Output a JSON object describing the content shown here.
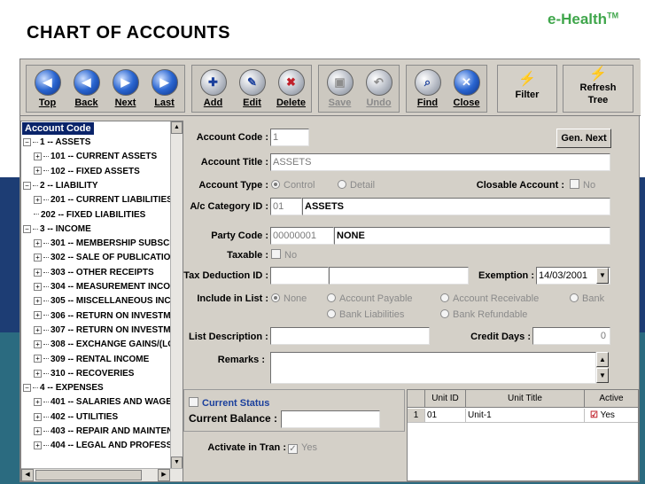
{
  "slide": {
    "title": "CHART OF ACCOUNTS",
    "brand": "e-Health",
    "brand_tm": "TM"
  },
  "toolbar": {
    "nav": [
      {
        "label": "Top",
        "icon": "arrow-first-icon"
      },
      {
        "label": "Back",
        "icon": "arrow-back-icon"
      },
      {
        "label": "Next",
        "icon": "arrow-next-icon"
      },
      {
        "label": "Last",
        "icon": "arrow-last-icon"
      }
    ],
    "edit": [
      {
        "label": "Add",
        "icon": "add-document-icon"
      },
      {
        "label": "Edit",
        "icon": "edit-document-icon"
      },
      {
        "label": "Delete",
        "icon": "delete-document-icon"
      }
    ],
    "save": [
      {
        "label": "Save",
        "icon": "save-icon",
        "disabled": true
      },
      {
        "label": "Undo",
        "icon": "undo-icon",
        "disabled": true
      }
    ],
    "find": [
      {
        "label": "Find",
        "icon": "find-icon"
      },
      {
        "label": "Close",
        "icon": "close-icon"
      }
    ],
    "filter": {
      "label": "Filter",
      "icon": "lightning-icon"
    },
    "refresh": {
      "label1": "Refresh",
      "label2": "Tree",
      "icon": "lightning-icon"
    }
  },
  "tree": {
    "header": "Account Code",
    "items": [
      {
        "text": "1 -- ASSETS",
        "level": 0,
        "expander": "−"
      },
      {
        "text": "101 -- CURRENT ASSETS",
        "level": 1,
        "expander": "+"
      },
      {
        "text": "102 -- FIXED ASSETS",
        "level": 1,
        "expander": "+"
      },
      {
        "text": "2 -- LIABILITY",
        "level": 0,
        "expander": "−"
      },
      {
        "text": "201 -- CURRENT LIABILITIES",
        "level": 1,
        "expander": "+"
      },
      {
        "text": "202 -- FIXED LIABILITIES",
        "level": 1,
        "expander": ""
      },
      {
        "text": "3 -- INCOME",
        "level": 0,
        "expander": "−"
      },
      {
        "text": "301 -- MEMBERSHIP SUBSCR",
        "level": 1,
        "expander": "+"
      },
      {
        "text": "302 -- SALE OF PUBLICATIO",
        "level": 1,
        "expander": "+"
      },
      {
        "text": "303 -- OTHER RECEIPTS",
        "level": 1,
        "expander": "+"
      },
      {
        "text": "304 -- MEASUREMENT INCOI",
        "level": 1,
        "expander": "+"
      },
      {
        "text": "305 -- MISCELLANEOUS INC(",
        "level": 1,
        "expander": "+"
      },
      {
        "text": "306 -- RETURN ON INVESTME",
        "level": 1,
        "expander": "+"
      },
      {
        "text": "307 -- RETURN ON INVESTME",
        "level": 1,
        "expander": "+"
      },
      {
        "text": "308 -- EXCHANGE GAINS/(LO",
        "level": 1,
        "expander": "+"
      },
      {
        "text": "309 -- RENTAL INCOME",
        "level": 1,
        "expander": "+"
      },
      {
        "text": "310 -- RECOVERIES",
        "level": 1,
        "expander": "+"
      },
      {
        "text": "4 -- EXPENSES",
        "level": 0,
        "expander": "−"
      },
      {
        "text": "401 -- SALARIES AND WAGE",
        "level": 1,
        "expander": "+"
      },
      {
        "text": "402 -- UTILITIES",
        "level": 1,
        "expander": "+"
      },
      {
        "text": "403 -- REPAIR AND MAINTEN",
        "level": 1,
        "expander": "+"
      },
      {
        "text": "404 -- LEGAL AND PROFESSI",
        "level": 1,
        "expander": "+"
      }
    ]
  },
  "form": {
    "account_code": {
      "label": "Account Code :",
      "value": "1"
    },
    "gen_next": "Gen. Next",
    "account_title": {
      "label": "Account Title :",
      "value": "ASSETS"
    },
    "account_type": {
      "label": "Account Type :",
      "options": [
        "Control",
        "Detail"
      ],
      "selected": "Control"
    },
    "closable": {
      "label": "Closable Account :",
      "value": "No"
    },
    "category": {
      "label": "A/c Category ID :",
      "code": "01",
      "name": "ASSETS"
    },
    "party": {
      "label": "Party Code :",
      "code": "00000001",
      "name": "NONE"
    },
    "taxable": {
      "label": "Taxable :",
      "value": "No"
    },
    "tax_deduction": {
      "label": "Tax Deduction ID :",
      "code": "",
      "name": ""
    },
    "exemption": {
      "label": "Exemption :",
      "value": "14/03/2001"
    },
    "include_in_list": {
      "label": "Include in List :",
      "row1": [
        "None",
        "Account Payable",
        "Account Receivable",
        "Bank"
      ],
      "row2": [
        "Bank Liabilities",
        "Bank Refundable"
      ],
      "selected": "None"
    },
    "list_description": {
      "label": "List Description :",
      "value": ""
    },
    "credit_days": {
      "label": "Credit Days :",
      "value": "0"
    },
    "remarks": {
      "label": "Remarks :",
      "value": ""
    },
    "current_status": {
      "label": "Current Status"
    },
    "current_balance": {
      "label": "Current Balance :",
      "value": ""
    },
    "activate": {
      "label": "Activate in Tran :",
      "value": "Yes"
    }
  },
  "grid": {
    "columns": [
      "Unit ID",
      "Unit Title",
      "Active"
    ],
    "rows": [
      {
        "row_no": "1",
        "unit_id": "01",
        "unit_title": "Unit-1",
        "active": "Yes"
      }
    ]
  }
}
